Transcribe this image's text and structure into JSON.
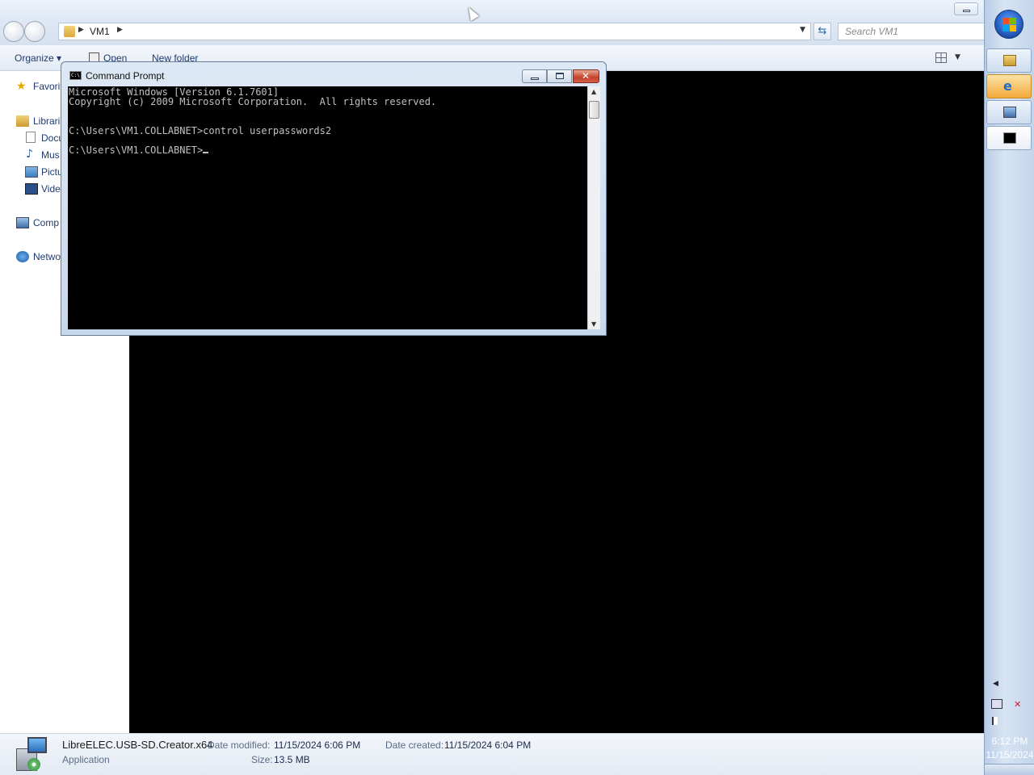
{
  "explorer": {
    "address": {
      "crumb": "VM1"
    },
    "search": {
      "placeholder": "Search VM1"
    },
    "toolbar": {
      "organize": "Organize ▾",
      "open": "Open",
      "new_folder": "New folder"
    },
    "nav": {
      "favorites": "Favorit",
      "libraries": "Librari",
      "documents": "Docu",
      "music": "Mus",
      "pictures": "Pictu",
      "videos": "Vide",
      "computer": "Comp",
      "network": "Netwo"
    },
    "details": {
      "file_name": "LibreELEC.USB-SD.Creator.x64",
      "file_type": "Application",
      "modified_label": "Date modified:",
      "modified_value": "11/15/2024 6:06 PM",
      "size_label": "Size:",
      "size_value": "13.5 MB",
      "created_label": "Date created:",
      "created_value": "11/15/2024 6:04 PM"
    }
  },
  "cmd": {
    "title": "Command Prompt",
    "icon_text": "C:\\",
    "lines": [
      "Microsoft Windows [Version 6.1.7601]",
      "Copyright (c) 2009 Microsoft Corporation.  All rights reserved.",
      "",
      "C:\\Users\\VM1.COLLABNET>control userpasswords2",
      "",
      "C:\\Users\\VM1.COLLABNET>"
    ]
  },
  "taskbar": {
    "clock_time": "6:12 PM",
    "clock_date": "11/15/2024",
    "items": [
      "windows-explorer-icon",
      "internet-explorer-icon",
      "remote-desktop-icon",
      "command-prompt-icon"
    ]
  },
  "colors": {
    "console_bg": "#000000",
    "console_text": "#c0c0c0",
    "close_button": "#c4412c"
  }
}
